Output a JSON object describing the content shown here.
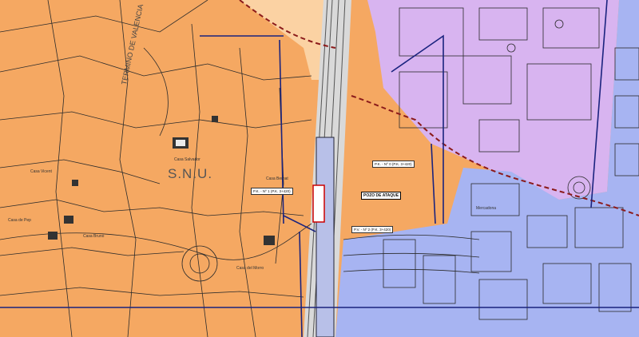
{
  "map": {
    "zone_label": "S.N.U.",
    "vertical_label": "TERMINO DE VALENCIA",
    "callouts": {
      "top_right": "P.K. - Nº 0 (P.K. 3+420)",
      "left": "P.K. - Nº 1 (P.K. 3+420)",
      "attack_pit": "POZO DE ATAQUE",
      "bottom": "P.V. - Nº 2 (P.K. 3+420)"
    },
    "place_labels": [
      "Casa Salvador",
      "Casa Bernat",
      "Casa Vicent",
      "Casa Bruno",
      "Casa del Morro",
      "Casa de Pep",
      "Mercadona"
    ],
    "colors": {
      "rustic": "#f5a862",
      "urban_residential": "#a7b4f2",
      "industrial": "#d8b4f0",
      "peach": "#fbd2a3",
      "boundary": "#1a237e",
      "parcel_line": "#2b2b2b"
    }
  }
}
